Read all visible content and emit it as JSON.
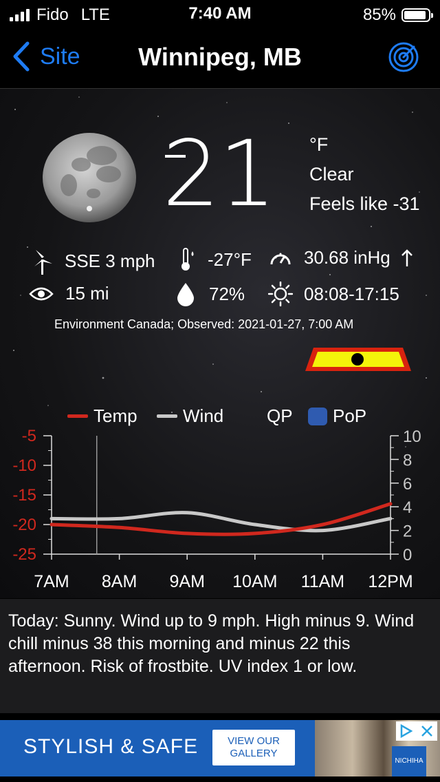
{
  "status_bar": {
    "carrier": "Fido",
    "network": "LTE",
    "time": "7:40 AM",
    "battery": "85%"
  },
  "nav": {
    "back_label": "Site",
    "title": "Winnipeg, MB"
  },
  "current": {
    "temperature": "21",
    "unit": "°F",
    "condition": "Clear",
    "feels_like": "Feels like -31",
    "wind": "SSE 3 mph",
    "dewpoint": "-27°F",
    "pressure": "30.68 inHg",
    "pressure_trend_icon": "arrow-up-icon",
    "visibility": "15 mi",
    "humidity": "72%",
    "sun": "08:08-17:15",
    "observed": "Environment Canada; Observed: 2021-01-27, 7:00 AM"
  },
  "chart_legend": {
    "temp": "Temp",
    "wind": "Wind",
    "qp": "QP",
    "pop": "PoP"
  },
  "chart_data": {
    "type": "line",
    "x": [
      "7AM",
      "8AM",
      "9AM",
      "10AM",
      "11AM",
      "12PM"
    ],
    "series": [
      {
        "name": "Temp",
        "color": "#d0281e",
        "axis": "left",
        "values": [
          -20,
          -20.5,
          -21.5,
          -21.5,
          -20,
          -16.5
        ]
      },
      {
        "name": "Wind",
        "color": "#c8c8c8",
        "axis": "right",
        "values": [
          3,
          3,
          3.5,
          2.5,
          2,
          3
        ]
      }
    ],
    "left_axis": {
      "ticks": [
        "-5",
        "-10",
        "-15",
        "-20",
        "-25"
      ],
      "ylim": [
        -25,
        -5
      ],
      "color": "#d0281e"
    },
    "right_axis": {
      "ticks": [
        "10",
        "8",
        "6",
        "4",
        "2",
        "0"
      ],
      "ylim": [
        0,
        10
      ],
      "color": "#c8c8c8"
    },
    "current_time_marker": "7:40 AM"
  },
  "forecast": {
    "text": "Today:  Sunny. Wind up to 9 mph. High minus 9. Wind chill minus 38 this morning and minus 22 this afternoon. Risk of frostbite. UV index 1 or low."
  },
  "ad": {
    "headline": "STYLISH & SAFE",
    "button_line1": "VIEW OUR",
    "button_line2": "GALLERY",
    "brand": "NICHIHA"
  }
}
